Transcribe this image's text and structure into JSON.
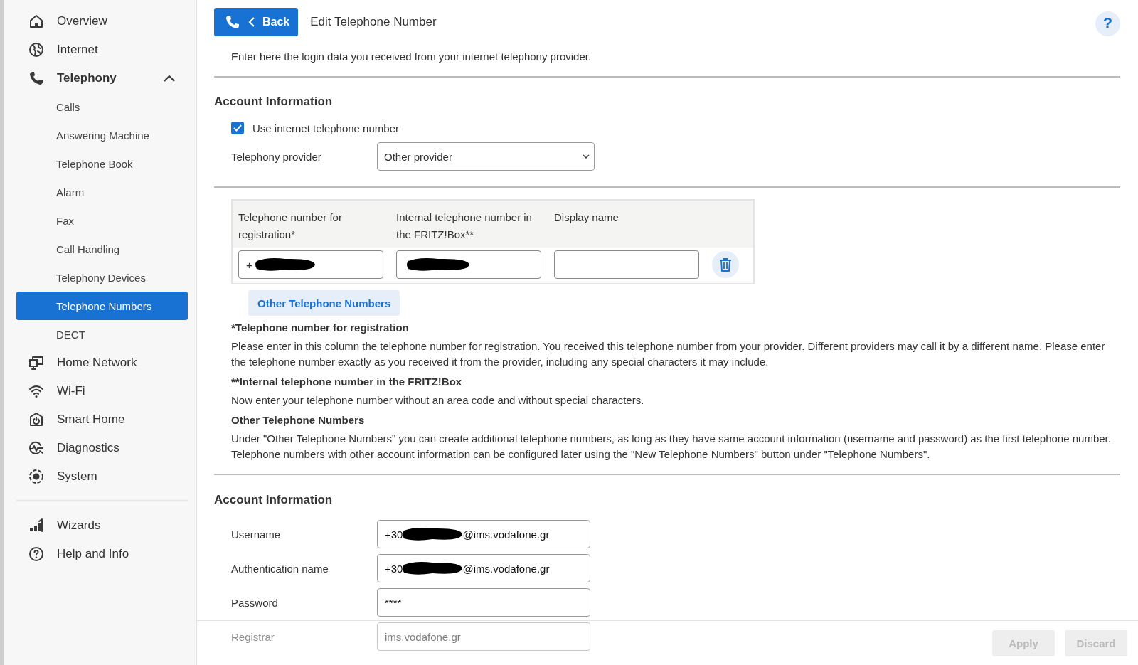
{
  "sidebar": {
    "items": [
      {
        "label": "Overview",
        "selected": false
      },
      {
        "label": "Internet",
        "selected": false
      },
      {
        "label": "Telephony",
        "selected": false,
        "expanded": true,
        "children": [
          {
            "label": "Calls",
            "selected": false
          },
          {
            "label": "Answering Machine",
            "selected": false
          },
          {
            "label": "Telephone Book",
            "selected": false
          },
          {
            "label": "Alarm",
            "selected": false
          },
          {
            "label": "Fax",
            "selected": false
          },
          {
            "label": "Call Handling",
            "selected": false
          },
          {
            "label": "Telephony Devices",
            "selected": false
          },
          {
            "label": "Telephone Numbers",
            "selected": true
          },
          {
            "label": "DECT",
            "selected": false
          }
        ]
      },
      {
        "label": "Home Network",
        "selected": false
      },
      {
        "label": "Wi-Fi",
        "selected": false
      },
      {
        "label": "Smart Home",
        "selected": false
      },
      {
        "label": "Diagnostics",
        "selected": false
      },
      {
        "label": "System",
        "selected": false
      }
    ],
    "footer_items": [
      {
        "label": "Wizards",
        "selected": false
      },
      {
        "label": "Help and Info",
        "selected": false
      }
    ]
  },
  "header": {
    "back_button": "Back",
    "title": "Edit Telephone Number",
    "help": "?"
  },
  "intro": "Enter here the login data you received from your internet telephony provider.",
  "account_section": {
    "heading": "Account Information",
    "use_internet_number": {
      "label": "Use internet telephone number",
      "checked": true
    },
    "provider": {
      "label": "Telephony provider",
      "value": "Other provider"
    }
  },
  "numbers_table": {
    "columns": [
      "Telephone number for registration*",
      "Internal telephone number in the FRITZ!Box**",
      "Display name"
    ],
    "rows": [
      {
        "cells": [
          {
            "prefix": "+",
            "redacted": true
          },
          {
            "redacted": true
          },
          {}
        ]
      }
    ]
  },
  "other_numbers_button": "Other Telephone Numbers",
  "notes": [
    {
      "heading": "*Telephone number for registration",
      "text": "Please enter in this column the telephone number for registration. You received this telephone number from your provider. Different providers may call it by a different name. Please enter the telephone number exactly as you received it from the provider, including any special characters it may include."
    },
    {
      "heading": "**Internal telephone number in the FRITZ!Box",
      "text": "Now enter your telephone number without an area code and without special characters."
    },
    {
      "heading": "Other Telephone Numbers",
      "text": "Under \"Other Telephone Numbers\" you can create additional telephone numbers, as long as they have same account information (username and password) as the first telephone number. Telephone numbers with other account information can be configured later using the \"New Telephone Numbers\" button under \"Telephone Numbers\"."
    }
  ],
  "login_section": {
    "heading": "Account Information",
    "fields": [
      {
        "label": "Username",
        "prefix": "+30",
        "suffix": "@ims.vodafone.gr",
        "redacted": true
      },
      {
        "label": "Authentication name",
        "prefix": "+30",
        "suffix": "@ims.vodafone.gr",
        "redacted": true
      },
      {
        "label": "Password",
        "prefix": "****"
      },
      {
        "label": "Registrar",
        "prefix": "ims.vodafone.gr"
      }
    ]
  },
  "footer": {
    "buttons": [
      {
        "label": "Apply",
        "disabled": true
      },
      {
        "label": "Discard",
        "disabled": true
      }
    ]
  }
}
